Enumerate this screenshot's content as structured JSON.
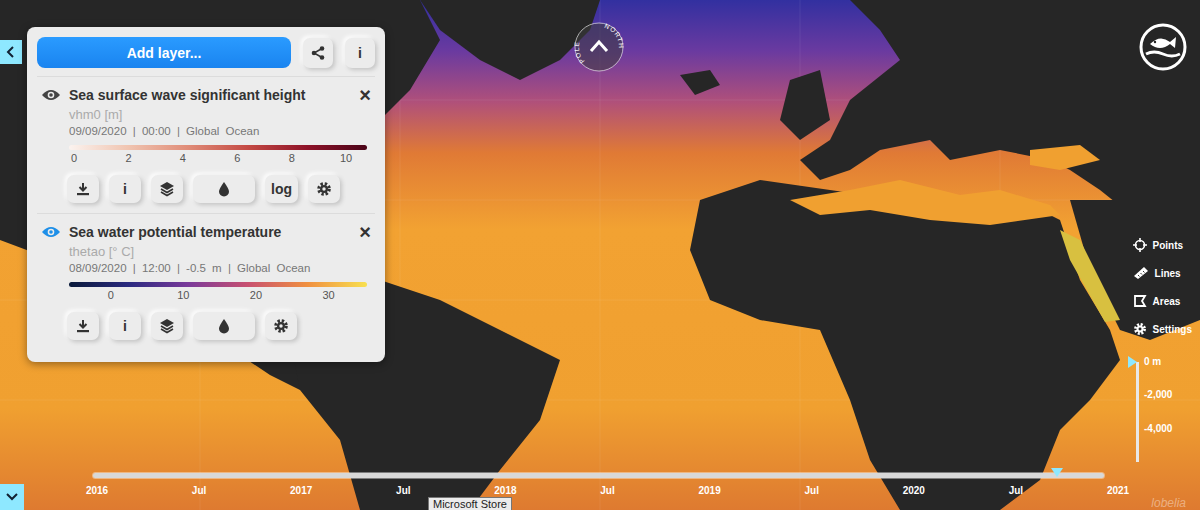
{
  "panel": {
    "add_layer": "Add layer..."
  },
  "layers": [
    {
      "title": "Sea surface wave significant height",
      "variable": "vhm0 [m]",
      "meta": "09/09/2020 | 00:00 | Global Ocean",
      "selected": false,
      "close": "×",
      "palette": [
        "#fbf3ef",
        "#f0c4b0",
        "#e08c78",
        "#c44a44",
        "#8e1228",
        "#4a0418"
      ],
      "range": [
        -0.19,
        10.77
      ],
      "ticks": [
        "0",
        "2",
        "4",
        "6",
        "8",
        "10"
      ],
      "buttons": [
        {
          "kind": "download"
        },
        {
          "kind": "info",
          "label": "i"
        },
        {
          "kind": "layers"
        },
        {
          "kind": "opacity"
        },
        {
          "kind": "text",
          "label": "log"
        },
        {
          "kind": "settings"
        }
      ]
    },
    {
      "title": "Sea water potential temperature",
      "variable": "thetao [° C]",
      "meta": "08/09/2020 | 12:00 | -0.5 m | Global Ocean",
      "selected": true,
      "close": "×",
      "palette": [
        "#0a1a3a",
        "#2a2a80",
        "#7a3a9a",
        "#c85070",
        "#f09040",
        "#f8e050"
      ],
      "range": [
        -5.76,
        35.3
      ],
      "ticks": [
        "0",
        "10",
        "20",
        "30"
      ],
      "buttons": [
        {
          "kind": "download"
        },
        {
          "kind": "info",
          "label": "i"
        },
        {
          "kind": "layers"
        },
        {
          "kind": "opacity"
        },
        {
          "kind": "settings"
        }
      ]
    }
  ],
  "header_info": "i",
  "compass": {
    "top": "NORTH",
    "bottom": "POLE"
  },
  "tools": [
    {
      "label": "Points",
      "kind": "points"
    },
    {
      "label": "Lines",
      "kind": "lines"
    },
    {
      "label": "Areas",
      "kind": "areas"
    },
    {
      "label": "Settings",
      "kind": "settings"
    }
  ],
  "depth": {
    "labels": [
      "0 m",
      "-2,000",
      "-4,000"
    ],
    "max": 6000,
    "level": 0
  },
  "timeline": {
    "labels": [
      "2016",
      "Jul",
      "2017",
      "Jul",
      "2018",
      "Jul",
      "2019",
      "Jul",
      "2020",
      "Jul",
      "2021"
    ],
    "level": 0.94
  },
  "tooltip": "Microsoft Store",
  "watermark": "lobelia"
}
